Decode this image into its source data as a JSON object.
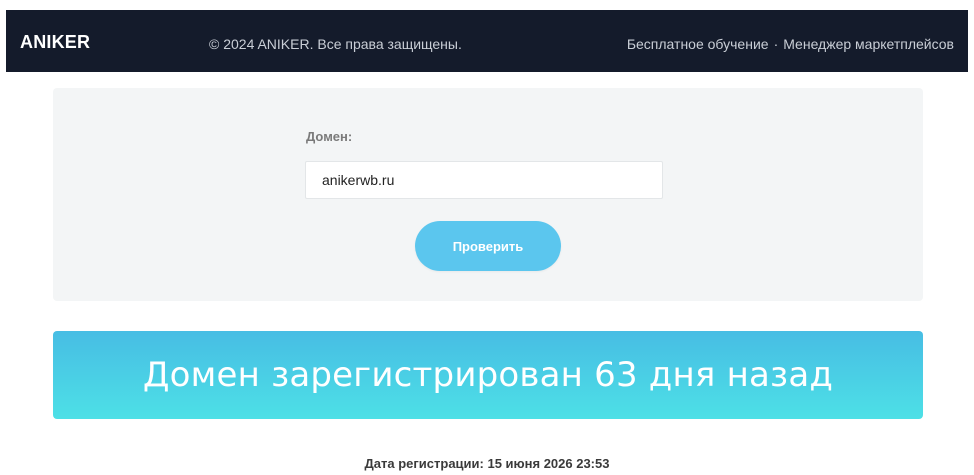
{
  "header": {
    "brand": "ANIKER",
    "copyright": "© 2024 ANIKER. Все права защищены.",
    "links": [
      {
        "label": "Бесплатное обучение"
      },
      {
        "label": "Менеджер маркетплейсов"
      }
    ],
    "separator": "·"
  },
  "form": {
    "domain_label": "Домен:",
    "domain_value": "anikerwb.ru",
    "submit_label": "Проверить"
  },
  "result": {
    "message": "Домен зарегистрирован 63 дня назад",
    "registration_date": "Дата регистрации: 15 июня 2026 23:53"
  },
  "colors": {
    "header_bg": "#141b2b",
    "card_bg": "#f3f5f6",
    "button_bg": "#5bc6ee",
    "banner_top": "#47bde4",
    "banner_bottom": "#4de0e6"
  }
}
